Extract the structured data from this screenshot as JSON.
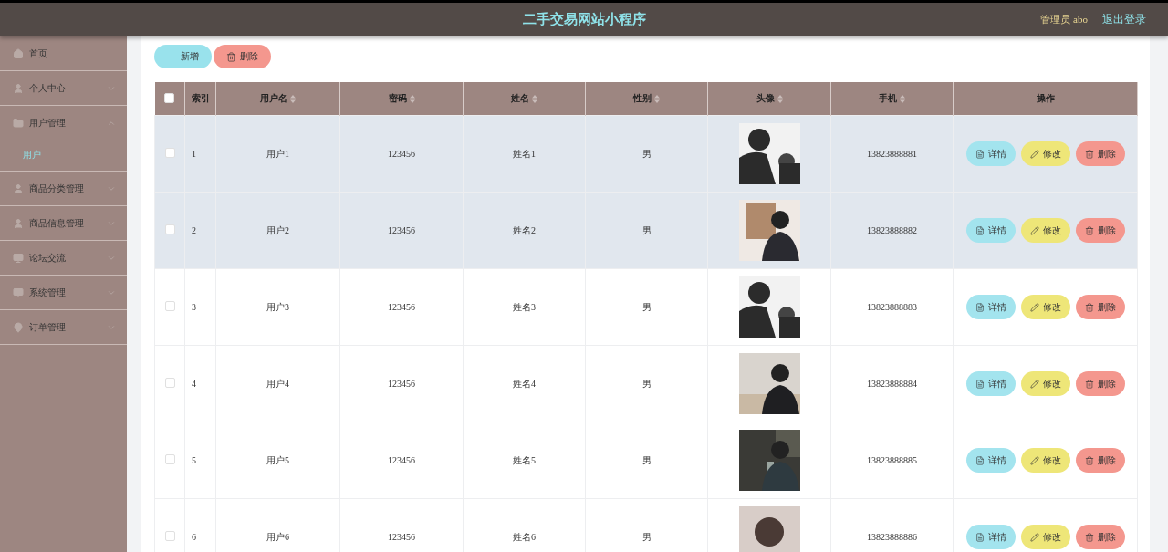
{
  "header": {
    "title": "二手交易网站小程序",
    "user": "管理员 abo",
    "logout": "退出登录"
  },
  "sidebar": {
    "items": [
      {
        "label": "首页",
        "expandable": false
      },
      {
        "label": "个人中心",
        "expandable": true,
        "expanded": false
      },
      {
        "label": "用户管理",
        "expandable": true,
        "expanded": true,
        "children": [
          {
            "label": "用户",
            "selected": true
          }
        ]
      },
      {
        "label": "商品分类管理",
        "expandable": true,
        "expanded": false
      },
      {
        "label": "商品信息管理",
        "expandable": true,
        "expanded": false
      },
      {
        "label": "论坛交流",
        "expandable": true,
        "expanded": false
      },
      {
        "label": "系统管理",
        "expandable": true,
        "expanded": false
      },
      {
        "label": "订单管理",
        "expandable": true,
        "expanded": false
      }
    ]
  },
  "toolbar": {
    "buttons": [
      {
        "label": "新增",
        "kind": "add"
      },
      {
        "label": "删除",
        "kind": "delete"
      }
    ]
  },
  "table": {
    "select_all_checked": false,
    "columns": [
      {
        "label": "索引",
        "sortable": false
      },
      {
        "label": "用户名",
        "sortable": true
      },
      {
        "label": "密码",
        "sortable": true
      },
      {
        "label": "姓名",
        "sortable": true
      },
      {
        "label": "性别",
        "sortable": true
      },
      {
        "label": "头像",
        "sortable": true
      },
      {
        "label": "手机",
        "sortable": true
      },
      {
        "label": "操作",
        "sortable": false
      }
    ],
    "rows": [
      {
        "index": "1",
        "username": "用户1",
        "password": "123456",
        "name": "姓名1",
        "gender": "男",
        "phone": "13823888881",
        "checked": false,
        "highlighted": true,
        "actions": [
          {
            "label": "详情",
            "kind": "detail"
          },
          {
            "label": "修改",
            "kind": "edit"
          },
          {
            "label": "删除",
            "kind": "delete"
          }
        ]
      },
      {
        "index": "2",
        "username": "用户2",
        "password": "123456",
        "name": "姓名2",
        "gender": "男",
        "phone": "13823888882",
        "checked": false,
        "highlighted": true,
        "actions": [
          {
            "label": "详情",
            "kind": "detail"
          },
          {
            "label": "修改",
            "kind": "edit"
          },
          {
            "label": "删除",
            "kind": "delete"
          }
        ]
      },
      {
        "index": "3",
        "username": "用户3",
        "password": "123456",
        "name": "姓名3",
        "gender": "男",
        "phone": "13823888883",
        "checked": false,
        "highlighted": false,
        "actions": [
          {
            "label": "详情",
            "kind": "detail"
          },
          {
            "label": "修改",
            "kind": "edit"
          },
          {
            "label": "删除",
            "kind": "delete"
          }
        ]
      },
      {
        "index": "4",
        "username": "用户4",
        "password": "123456",
        "name": "姓名4",
        "gender": "男",
        "phone": "13823888884",
        "checked": false,
        "highlighted": false,
        "actions": [
          {
            "label": "详情",
            "kind": "detail"
          },
          {
            "label": "修改",
            "kind": "edit"
          },
          {
            "label": "删除",
            "kind": "delete"
          }
        ]
      },
      {
        "index": "5",
        "username": "用户5",
        "password": "123456",
        "name": "姓名5",
        "gender": "男",
        "phone": "13823888885",
        "checked": false,
        "highlighted": false,
        "actions": [
          {
            "label": "详情",
            "kind": "detail"
          },
          {
            "label": "修改",
            "kind": "edit"
          },
          {
            "label": "删除",
            "kind": "delete"
          }
        ]
      },
      {
        "index": "6",
        "username": "用户6",
        "password": "123456",
        "name": "姓名6",
        "gender": "男",
        "phone": "13823888886",
        "checked": false,
        "highlighted": false,
        "actions": [
          {
            "label": "详情",
            "kind": "detail"
          },
          {
            "label": "修改",
            "kind": "edit"
          },
          {
            "label": "删除",
            "kind": "delete"
          }
        ]
      }
    ]
  }
}
